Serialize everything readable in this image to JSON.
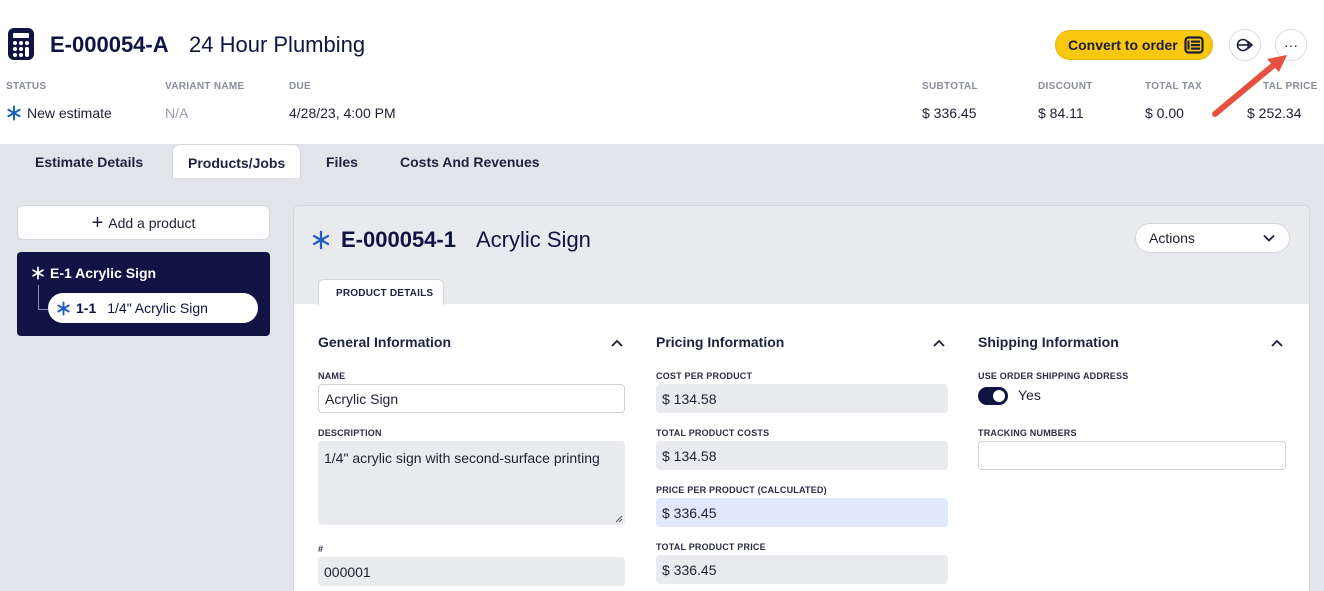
{
  "header": {
    "estimate_id": "E-000054-A",
    "customer_name": "24 Hour Plumbing",
    "convert_label": "Convert to order",
    "more_label": "···",
    "stats": [
      {
        "label": "STATUS",
        "value": "New estimate"
      },
      {
        "label": "VARIANT NAME",
        "value": "N/A"
      },
      {
        "label": "DUE",
        "value": "4/28/23, 4:00 PM"
      },
      {
        "label": "SUBTOTAL",
        "value": "$ 336.45"
      },
      {
        "label": "DISCOUNT",
        "value": "$ 84.11"
      },
      {
        "label": "TOTAL TAX",
        "value": "$ 0.00"
      },
      {
        "label": "TAL PRICE",
        "value": "$ 252.34"
      }
    ]
  },
  "tabs": [
    "Estimate Details",
    "Products/Jobs",
    "Files",
    "Costs And Revenues"
  ],
  "active_tab": "Products/Jobs",
  "sidebar": {
    "add_label": "Add a product",
    "plus_symbol": "+",
    "root_item": "E-1 Acrylic Sign",
    "child_number": "1-1",
    "child_label": "1/4\" Acrylic Sign"
  },
  "product": {
    "id": "E-000054-1",
    "name": "Acrylic Sign",
    "actions_label": "Actions",
    "subtab_label": "PRODUCT DETAILS"
  },
  "general": {
    "title": "General Information",
    "name_label": "NAME",
    "name_value": "Acrylic Sign",
    "description_label": "DESCRIPTION",
    "description_value": "1/4\" acrylic sign with second-surface printing",
    "number_label": "#",
    "number_value": "000001"
  },
  "pricing": {
    "title": "Pricing Information",
    "cost_label": "COST PER PRODUCT",
    "cost_value": "$ 134.58",
    "total_costs_label": "TOTAL PRODUCT COSTS",
    "total_costs_value": "$ 134.58",
    "price_label": "PRICE PER PRODUCT (CALCULATED)",
    "price_value": "$ 336.45",
    "total_price_label": "TOTAL PRODUCT PRICE",
    "total_price_value": "$ 336.45"
  },
  "shipping": {
    "title": "Shipping Information",
    "use_order_label": "USE ORDER SHIPPING ADDRESS",
    "use_order_value": "Yes",
    "tracking_label": "TRACKING NUMBERS",
    "tracking_value": ""
  },
  "colors": {
    "navy": "#0f1445",
    "accent_yellow": "#f9c80e",
    "arrow_red": "#e8503e",
    "asterisk_blue": "#1f5fbf"
  },
  "icons": {
    "logo": "calculator-icon",
    "convert": "order-icon",
    "split": "split-icon",
    "more": "more-icon",
    "status": "asterisk-icon"
  }
}
